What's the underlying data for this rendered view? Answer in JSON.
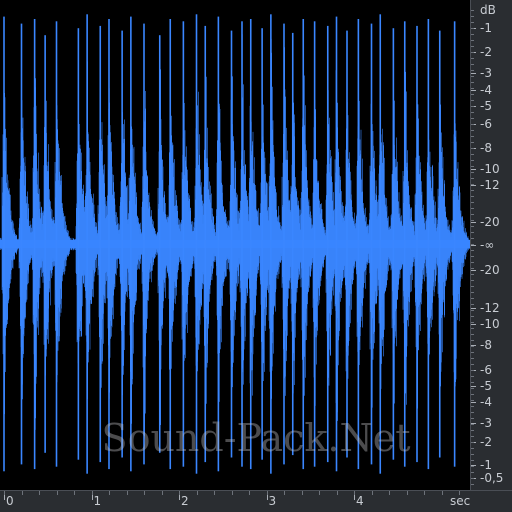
{
  "watermark": "Sound-Pack.Net",
  "colors": {
    "waveform": "#3a86ff",
    "background": "#000000",
    "ruler": "#2a2d31",
    "label": "#c8ccd2"
  },
  "db_scale": {
    "unit": "dB",
    "labels": [
      "-1",
      "-2",
      "-3",
      "-4",
      "-5",
      "-6",
      "-8",
      "-10",
      "-12",
      "-20",
      "-∞",
      "-20",
      "-12",
      "-10",
      "-8",
      "-6",
      "-5",
      "-4",
      "-3",
      "-2",
      "-1",
      "-0,5"
    ]
  },
  "time_scale": {
    "unit": "sec",
    "labels": [
      "0",
      "1",
      "2",
      "3",
      "4"
    ]
  },
  "waveform": {
    "duration_sec": 5.3,
    "burst_times_sec": [
      0.0,
      0.2,
      0.35,
      0.47,
      0.6,
      0.85,
      0.95,
      1.1,
      1.2,
      1.35,
      1.45,
      1.6,
      1.78,
      1.9,
      2.05,
      2.2,
      2.3,
      2.45,
      2.6,
      2.72,
      2.82,
      2.95,
      3.05,
      3.2,
      3.3,
      3.42,
      3.55,
      3.7,
      3.8,
      3.92,
      4.05,
      4.2,
      4.3,
      4.45,
      4.58,
      4.72,
      4.85,
      4.98,
      5.15
    ],
    "peak_amplitudes": [
      0.98,
      0.95,
      0.97,
      0.9,
      0.96,
      0.93,
      0.99,
      0.94,
      0.97,
      0.92,
      0.98,
      0.95,
      0.9,
      0.97,
      0.96,
      0.99,
      0.94,
      0.98,
      0.92,
      0.96,
      0.97,
      0.93,
      0.99,
      0.95,
      0.91,
      0.97,
      0.96,
      0.94,
      0.98,
      0.92,
      0.97,
      0.95,
      0.99,
      0.93,
      0.96,
      0.94,
      0.97,
      0.92,
      0.96
    ]
  }
}
